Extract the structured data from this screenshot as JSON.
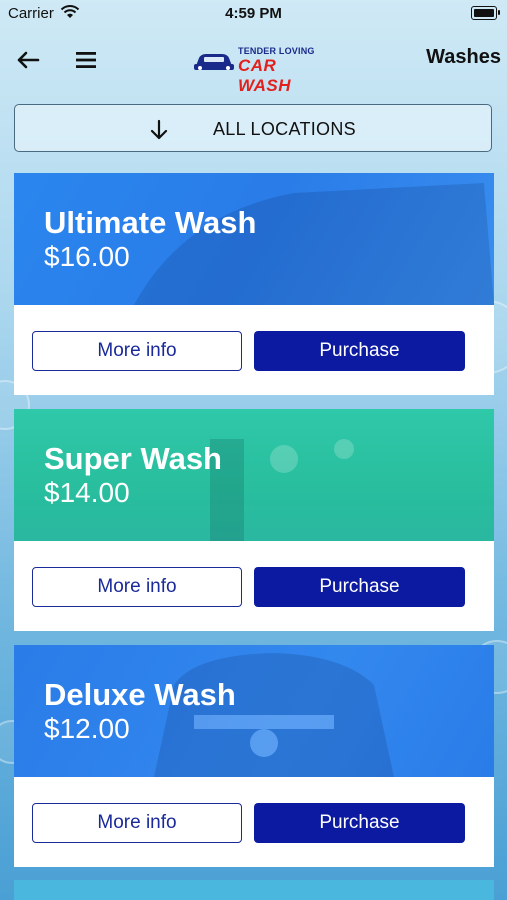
{
  "status_bar": {
    "carrier": "Carrier",
    "time": "4:59 PM"
  },
  "nav": {
    "logo_top": "TENDER LOVING",
    "logo_bottom": "CAR WASH",
    "title": "Washes"
  },
  "location_filter": {
    "label": "ALL LOCATIONS"
  },
  "washes": [
    {
      "name": "Ultimate Wash",
      "price": "$16.00",
      "more_label": "More info",
      "buy_label": "Purchase",
      "color": "#2a7ce8"
    },
    {
      "name": "Super Wash",
      "price": "$14.00",
      "more_label": "More info",
      "buy_label": "Purchase",
      "color": "#2bc2a2"
    },
    {
      "name": "Deluxe Wash",
      "price": "$12.00",
      "more_label": "More info",
      "buy_label": "Purchase",
      "color": "#2a7ce8"
    }
  ],
  "colors": {
    "primary_button": "#0b1aa0",
    "logo_red": "#e2211c",
    "logo_blue": "#1a2a8a"
  }
}
